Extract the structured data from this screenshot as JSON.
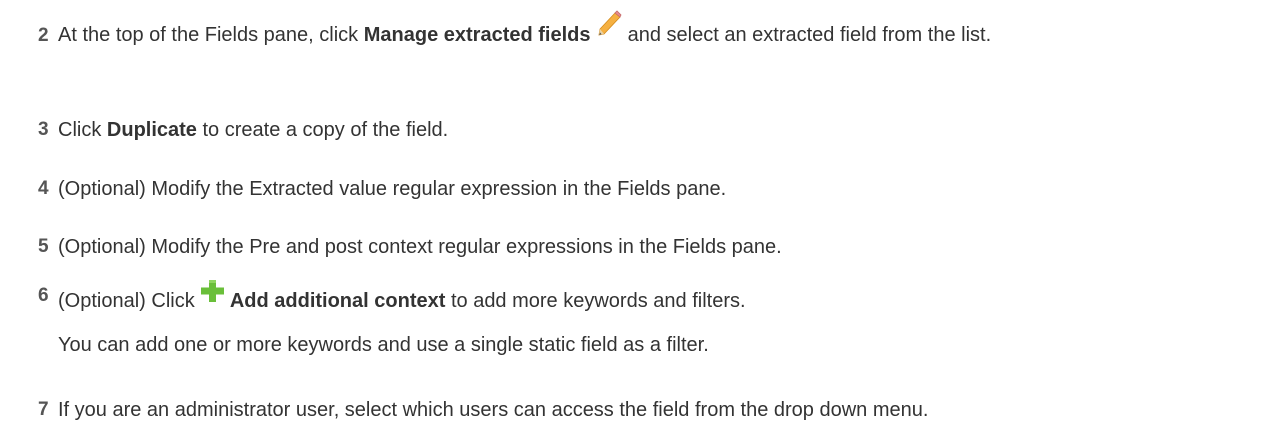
{
  "steps": [
    {
      "number": "2",
      "pre": "At the top of the Fields pane, click",
      "bold": "Manage extracted fields",
      "icon": "pencil-icon",
      "post": "and select an extracted field from the list."
    },
    {
      "number": "3",
      "pre": "Click",
      "bold": "Duplicate",
      "post": "to create a copy of the field."
    },
    {
      "number": "4",
      "text": "(Optional) Modify the Extracted value regular expression in the Fields pane."
    },
    {
      "number": "5",
      "text": "(Optional) Modify the Pre and post context regular expressions in the Fields pane."
    },
    {
      "number": "6",
      "pre": "(Optional) Click",
      "icon": "plus-icon",
      "bold": "Add additional context",
      "post": "to add more keywords and filters.",
      "note": "You can add one or more keywords and use a single static field as a filter."
    },
    {
      "number": "7",
      "text": "If you are an administrator user, select which users can access the field from the drop down menu."
    }
  ],
  "colors": {
    "text": "#333333",
    "number": "#555555",
    "plus": "#6abf3a",
    "pencil": "#f0a830"
  }
}
